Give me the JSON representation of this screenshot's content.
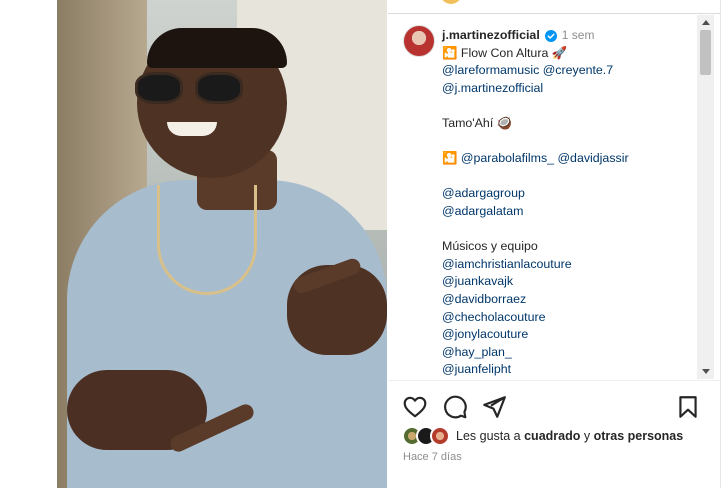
{
  "post": {
    "username": "j.martinezofficial",
    "verified": true,
    "time_short": "1 sem",
    "caption_lines": [
      "🎦 Flow Con Altura 🚀",
      "@lareformamusic @creyente.7",
      "@j.martinezofficial",
      "",
      "Tamo'Ahí 🥥",
      "",
      "🎦 @parabolafilms_ @davidjassir",
      "",
      "@adargagroup",
      "@adargalatam",
      "",
      "Músicos y equipo",
      "@iamchristianlacouture",
      "@juankavajk",
      "@davidborraez",
      "@checholacouture",
      "@jonylacouture",
      "@hay_plan_",
      "@juanfelipht"
    ]
  },
  "actions": {
    "like_icon": "heart-icon",
    "comment_icon": "comment-icon",
    "share_icon": "send-icon",
    "save_icon": "bookmark-icon"
  },
  "likes": {
    "prefix": "Les gusta a ",
    "user": "cuadrado",
    "middle": " y ",
    "others": "otras personas"
  },
  "posted_ago": "Hace 7 días",
  "colors": {
    "text": "#262626",
    "secondary": "#8e8e8e",
    "verified": "#0095f6",
    "mention": "#00376b"
  }
}
